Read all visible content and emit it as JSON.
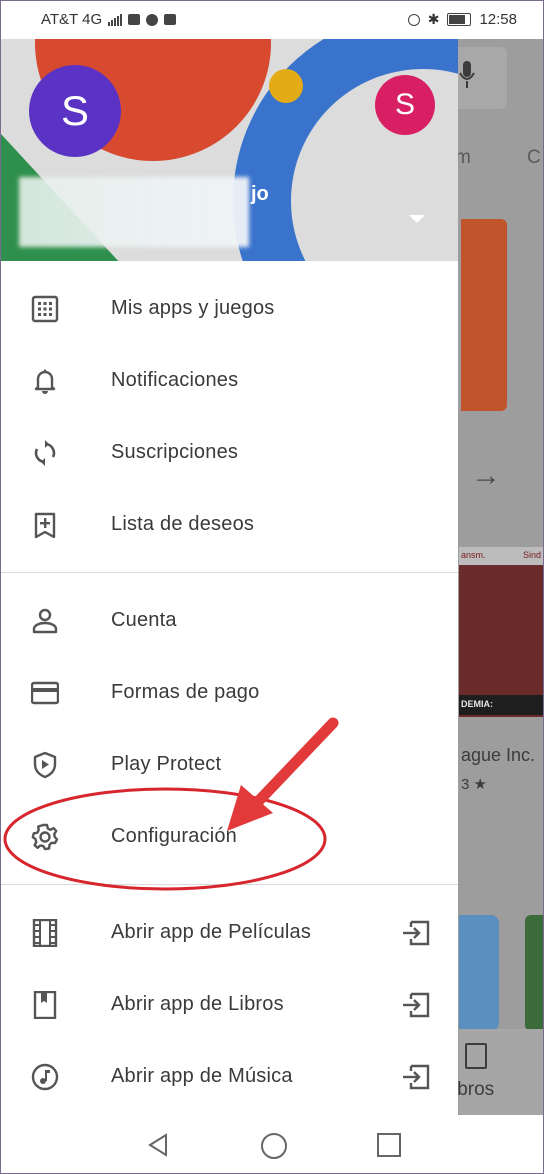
{
  "status_bar": {
    "carrier": "AT&T 4G",
    "time": "12:58"
  },
  "account": {
    "avatar_letter": "S",
    "name_suffix": "jo",
    "secondary_avatar_letter": "S"
  },
  "menu": {
    "group1": [
      {
        "label": "Mis apps y juegos",
        "icon": "apps-grid-icon"
      },
      {
        "label": "Notificaciones",
        "icon": "bell-icon"
      },
      {
        "label": "Suscripciones",
        "icon": "refresh-icon"
      },
      {
        "label": "Lista de deseos",
        "icon": "bookmark-add-icon"
      }
    ],
    "group2": [
      {
        "label": "Cuenta",
        "icon": "person-icon"
      },
      {
        "label": "Formas de pago",
        "icon": "credit-card-icon"
      },
      {
        "label": "Play Protect",
        "icon": "shield-play-icon"
      },
      {
        "label": "Configuración",
        "icon": "gear-icon"
      }
    ],
    "group3": [
      {
        "label": "Abrir app de Películas",
        "icon": "film-icon"
      },
      {
        "label": "Abrir app de Libros",
        "icon": "book-icon"
      },
      {
        "label": "Abrir app de Música",
        "icon": "music-note-icon"
      }
    ]
  },
  "background_app": {
    "tab_partial_1": "m",
    "tab_partial_2": "C",
    "game_title": "ague Inc.",
    "game_rating": "3 ★",
    "game_banner_left": "ansm.",
    "game_banner_right": "Sind",
    "game_caption": "DEMIA:",
    "bottom_nav_label": "ibros"
  },
  "colors": {
    "avatar": "#5a33c4",
    "secondary_avatar": "#d81f63",
    "annotation": "#e23a3a"
  }
}
